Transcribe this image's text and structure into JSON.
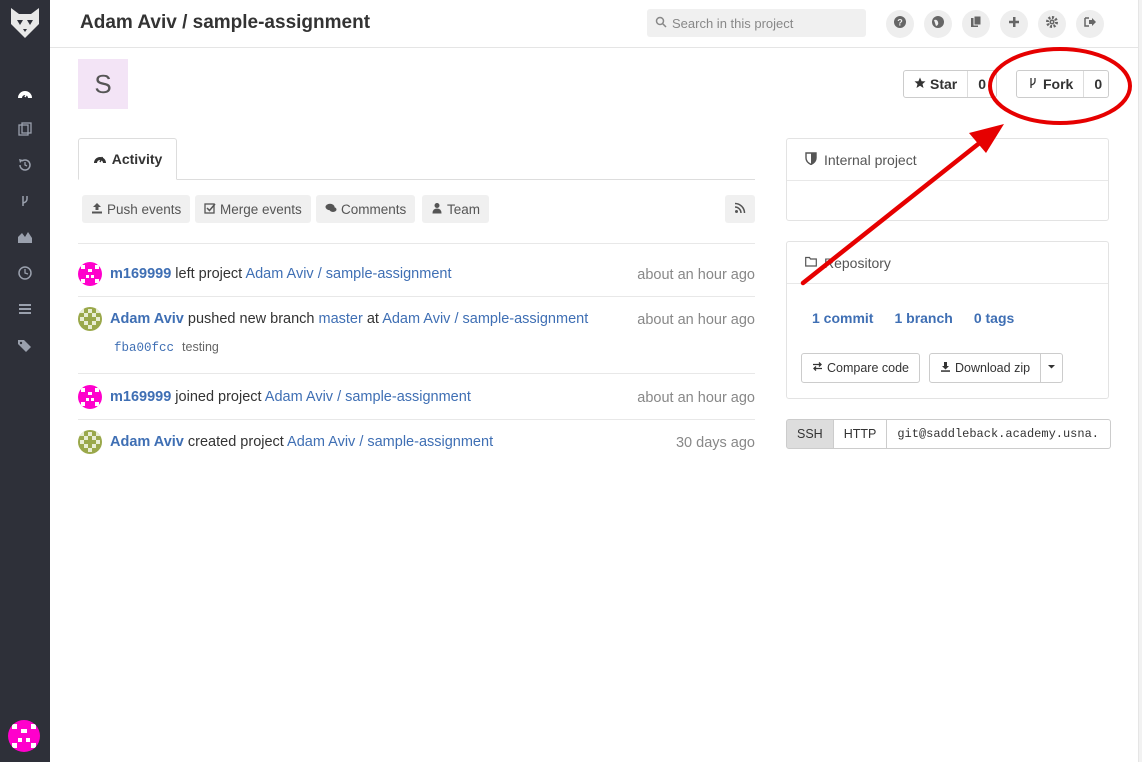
{
  "header": {
    "title": "Adam Aviv / sample-assignment",
    "search_placeholder": "Search in this project",
    "icons": [
      "help-icon",
      "globe-icon",
      "copy-icon",
      "plus-icon",
      "gear-icon",
      "sign-out-icon"
    ]
  },
  "sidebar": {
    "items": [
      "dashboard-icon",
      "files-icon",
      "history-icon",
      "branch-icon",
      "graph-icon",
      "clock-icon",
      "list-icon",
      "tags-icon"
    ]
  },
  "project": {
    "avatar_letter": "S",
    "star_label": "Star",
    "star_count": "0",
    "fork_label": "Fork",
    "fork_count": "0"
  },
  "tabs": {
    "activity_label": "Activity"
  },
  "filters": {
    "push": "Push events",
    "merge": "Merge events",
    "comments": "Comments",
    "team": "Team"
  },
  "events": [
    {
      "user": "m169999",
      "action": " left project ",
      "target": "Adam Aviv / sample-assignment",
      "time": "about an hour ago"
    },
    {
      "user": "Adam Aviv",
      "action": " pushed new branch ",
      "branch": "master",
      "at": " at ",
      "target": "Adam Aviv / sample-assignment",
      "time": "about an hour ago",
      "commit_sha": "fba00fcc",
      "commit_msg": "testing"
    },
    {
      "user": "m169999",
      "action": " joined project ",
      "target": "Adam Aviv / sample-assignment",
      "time": "about an hour ago"
    },
    {
      "user": "Adam Aviv",
      "action": " created project ",
      "target": "Adam Aviv / sample-assignment",
      "time": "30 days ago"
    }
  ],
  "sidebar_panels": {
    "visibility": "Internal project",
    "repository_title": "Repository",
    "commits": "1 commit",
    "branches": "1 branch",
    "tags": "0 tags",
    "compare": "Compare code",
    "download": "Download zip"
  },
  "clone": {
    "ssh": "SSH",
    "http": "HTTP",
    "url": "git@saddleback.academy.usna."
  },
  "colors": {
    "sidebar": "#2e3039",
    "link": "#3f6fb4",
    "annotation": "#e60000",
    "avatar_magenta": "#ff00cc",
    "avatar_olive": "#9aa84a"
  }
}
